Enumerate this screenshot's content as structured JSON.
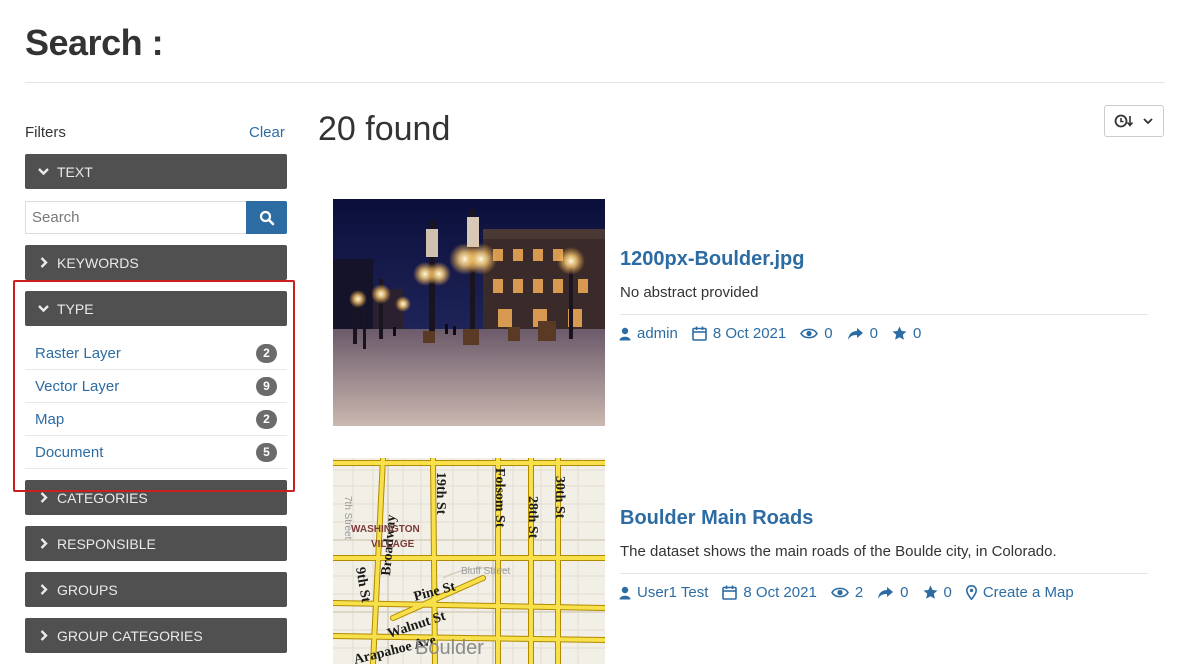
{
  "page": {
    "title": "Search :"
  },
  "sidebar": {
    "filters_label": "Filters",
    "clear_label": "Clear",
    "search": {
      "placeholder": "Search",
      "value": ""
    },
    "facets": {
      "text": "TEXT",
      "keywords": "KEYWORDS",
      "type": "TYPE",
      "categories": "CATEGORIES",
      "responsible": "RESPONSIBLE",
      "groups": "GROUPS",
      "group_categories": "GROUP CATEGORIES"
    },
    "type_items": [
      {
        "label": "Raster Layer",
        "count": "2"
      },
      {
        "label": "Vector Layer",
        "count": "9"
      },
      {
        "label": "Map",
        "count": "2"
      },
      {
        "label": "Document",
        "count": "5"
      }
    ]
  },
  "main": {
    "found": "20 found",
    "results": [
      {
        "title": "1200px-Boulder.jpg",
        "abstract": "No abstract provided",
        "owner": "admin",
        "date": "8 Oct 2021",
        "views": "0",
        "shares": "0",
        "stars": "0"
      },
      {
        "title": "Boulder Main Roads",
        "abstract": "The dataset shows the main roads of the Boulde city, in Colorado.",
        "owner": "User1 Test",
        "date": "8 Oct 2021",
        "views": "2",
        "shares": "0",
        "stars": "0",
        "action": "Create a Map"
      }
    ]
  },
  "map_labels": {
    "washington": "WASHINGTON",
    "village": "VILLAGE",
    "broadway": "Broadway",
    "st19": "19th St",
    "folsom": "Folsom St",
    "st28": "28th St",
    "st30": "30th St",
    "st7": "7th Street",
    "st9": "9th St",
    "bluff": "Bluff Street",
    "pine": "Pine St",
    "walnut": "Walnut St",
    "arapahoe": "Arapahoe Ave",
    "boulder": "Boulder"
  },
  "colors": {
    "accent": "#2c6ca3",
    "facet_bg": "#505050",
    "highlight": "#cc1f1f",
    "badge": "#6b6b6b"
  }
}
